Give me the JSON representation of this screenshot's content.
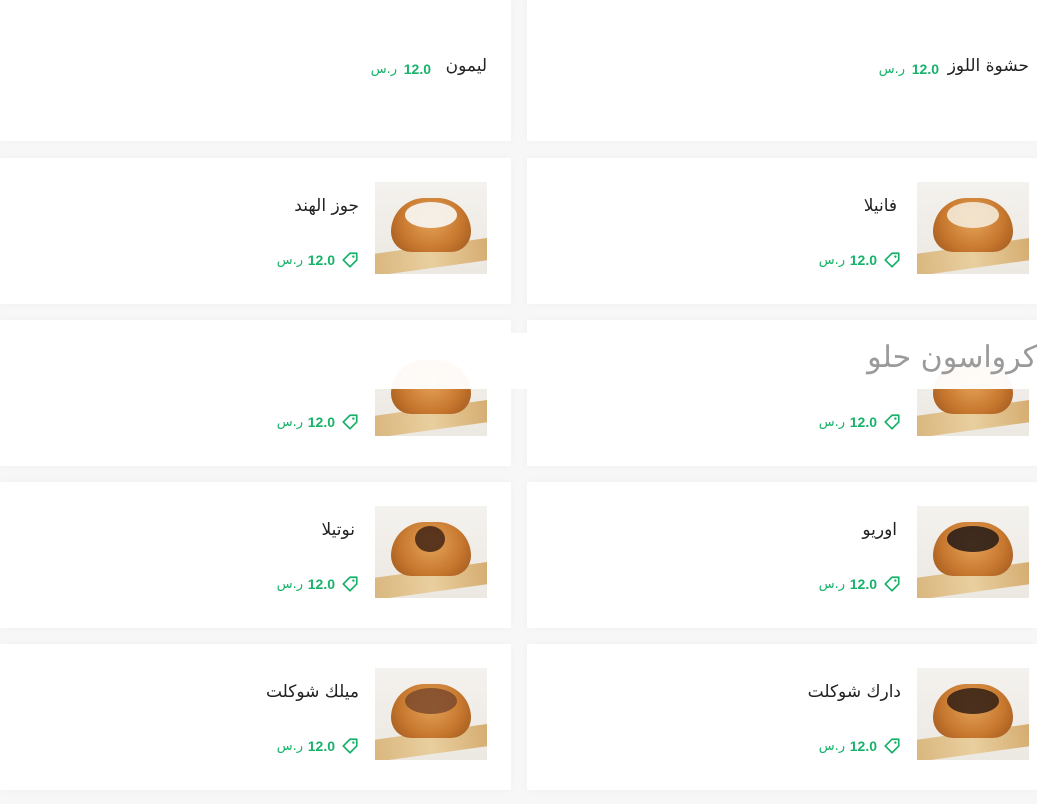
{
  "currency": "ر.س",
  "category": {
    "title": "كرواسون حلو"
  },
  "top_row": {
    "right": {
      "name": "حشوة اللوز",
      "price": "12.0"
    },
    "left": {
      "name": "ليمون",
      "price": "12.0"
    }
  },
  "items": [
    {
      "name": "فانيلا",
      "price": "12.0",
      "topping": "#f4ead8"
    },
    {
      "name": "جوز الهند",
      "price": "12.0",
      "topping": "#f7f3ee"
    },
    {
      "name": "",
      "price": "12.0",
      "topping": "#d38b3a"
    },
    {
      "name": "",
      "price": "12.0",
      "topping": "#d38b3a"
    },
    {
      "name": "اوريو",
      "price": "12.0",
      "topping": "#2c1f18"
    },
    {
      "name": "نوتيلا",
      "price": "12.0",
      "topping": "#4a2a17"
    },
    {
      "name": "دارك شوكلت",
      "price": "12.0",
      "topping": "#3a2416"
    },
    {
      "name": "ميلك شوكلت",
      "price": "12.0",
      "topping": "#7b4a2b"
    }
  ],
  "colors": {
    "accent": "#17b26a",
    "text": "#222222"
  },
  "icons": {
    "price": "tag-icon"
  }
}
